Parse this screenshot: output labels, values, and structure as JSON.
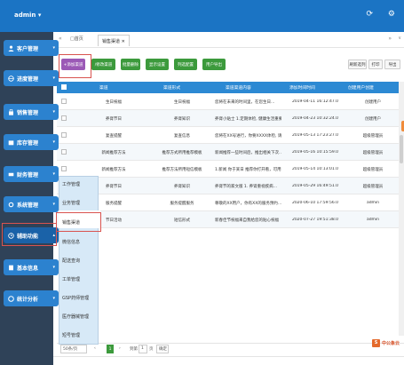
{
  "header": {
    "admin_label": "admin ▾",
    "refresh_icon": "refresh-icon",
    "gear_icon": "gear-icon"
  },
  "tabs": {
    "home": "首页",
    "active": "销售渠道"
  },
  "sidebar": {
    "items": [
      {
        "label": "客户管理",
        "icon": "user-icon"
      },
      {
        "label": "进度管理",
        "icon": "globe-icon"
      },
      {
        "label": "销售管理",
        "icon": "bag-icon"
      },
      {
        "label": "库存管理",
        "icon": "box-icon"
      },
      {
        "label": "财务管理",
        "icon": "money-icon"
      },
      {
        "label": "系统管理",
        "icon": "gear-icon"
      },
      {
        "label": "辅助功能",
        "icon": "clock-icon"
      },
      {
        "label": "基本信息",
        "icon": "book-icon"
      },
      {
        "label": "统计分析",
        "icon": "chart-icon"
      }
    ]
  },
  "submenu": {
    "items": [
      "工作管理",
      "业务管理",
      "销售渠道",
      "微信信息",
      "配送查询",
      "工单管理",
      "GSP药师管理",
      "医疗器械管理",
      "短号管理"
    ]
  },
  "toolbar": {
    "add": "+添加渠道",
    "edit": "/修改渠道",
    "del": "批量删除",
    "show_config": "显示设置",
    "col_config": "列选配置",
    "user_export": "用户导出",
    "refresh": "刷新选列",
    "print": "打印",
    "export": "导出"
  },
  "table": {
    "headers": [
      "渠道",
      "渠道形式",
      "渠道渠道内容",
      "添加时间时间",
      "创建用户创建"
    ],
    "rows": [
      [
        "生日祝福",
        "生日祝福",
        "您将在未来的时间里，在您生日…",
        "2019-04-11 16:12:47.0",
        "创建用户"
      ],
      [
        "养肾节日",
        "养肾知识",
        "养肾小贴士 1.定期体检, 健康生活重要…",
        "2019-04-23 10:32:24.0",
        "创建用户"
      ],
      [
        "复查提醒",
        "复查信息",
        "您将在XX号进行，你要XXXX体检, 请您…",
        "2019-05-13 17:23:27.0",
        "超级管理员"
      ],
      [
        "新闻推荐方法",
        "推荐方式所用推荐模板",
        "新闻推荐一些时间后，推出相关下次…",
        "2019-05-16 10:15:59.0",
        "超级管理员"
      ],
      [
        "新闻推荐方法",
        "推荐方法所用短信模板",
        "1.新闻 你于某日 推荐你打开看，可用…",
        "2019-05-14 10:13:01.0",
        "超级管理员"
      ],
      [
        "养肾节日",
        "养肾知识",
        "养肾节的家文版 1. 养肾重视疾病…",
        "2019-05-29 16:49:51.0",
        "超级管理员"
      ],
      [
        "服务提醒",
        "服务提醒服务",
        "尊敬的XX用户，你有XX的服务预约…",
        "2020-06-10 17:59:56.0",
        "admin"
      ],
      [
        "节日活动",
        "短信形式",
        "新春佳节祝福来自我给您的贴心祝福",
        "2020-07-27 19:51:38.0",
        "admin"
      ]
    ]
  },
  "pager": {
    "page_size": "50条/页",
    "first": "‹",
    "current": "1",
    "next": "›",
    "goto": "到第",
    "page_num": "1",
    "page_unit": "页",
    "confirm": "确定"
  },
  "logo": {
    "text": "中公象云",
    "glyph": "S"
  },
  "colors": {
    "topbar": "#1b74c4",
    "sidebar": "#2f4258",
    "side_item": "#2c82cf",
    "table_header": "#2c89d3",
    "submenu_bg": "#d7e9f7",
    "highlight": "#d9534f"
  }
}
